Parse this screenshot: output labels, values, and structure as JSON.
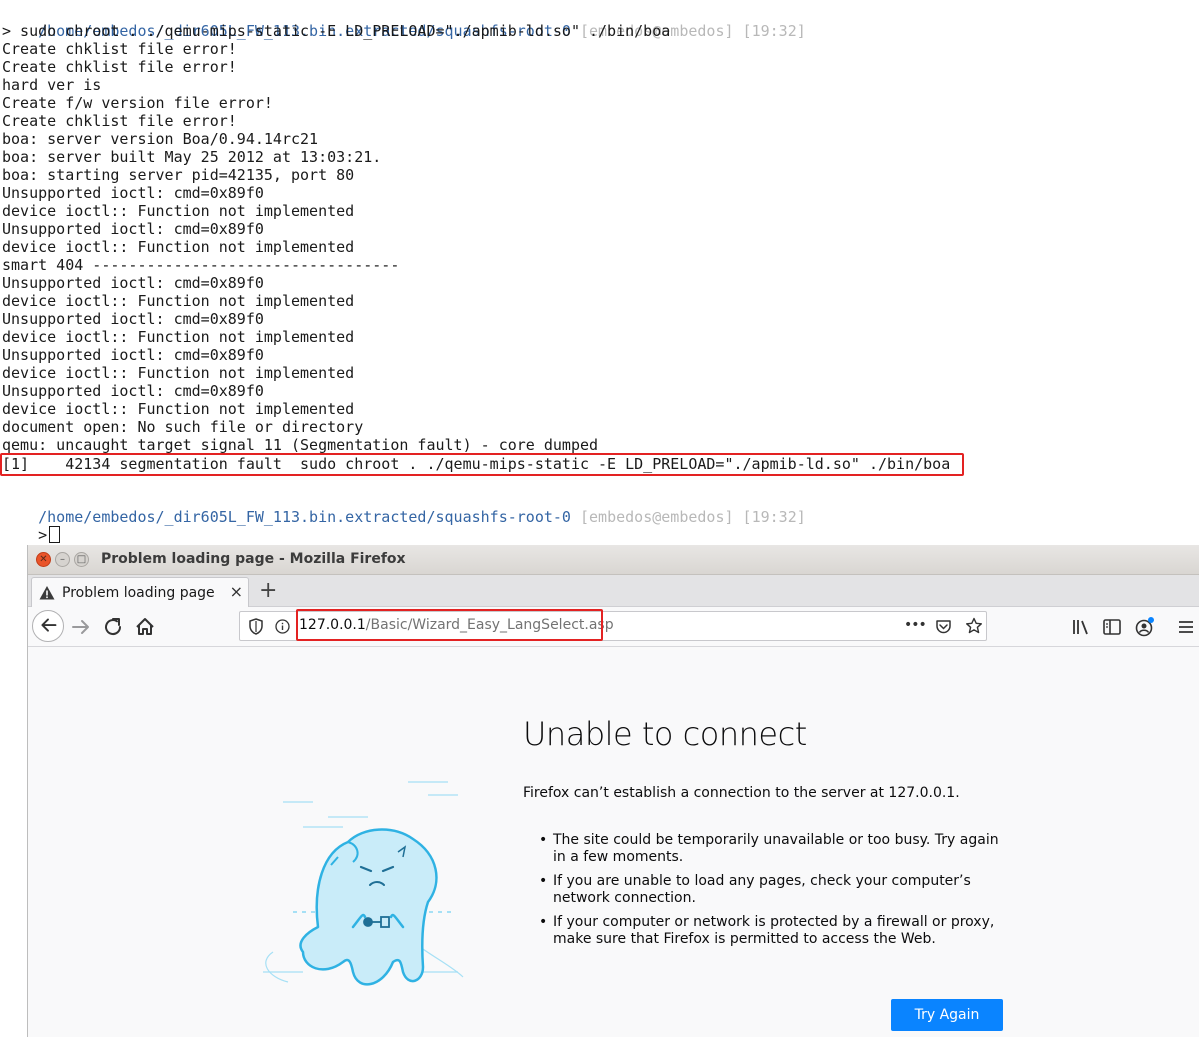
{
  "terminal": {
    "prompt_path": "/home/embedos/_dir605L_FW_113.bin.extracted/squashfs-root-0",
    "prompt_user": "[embedos@embedos]",
    "prompt_time": "[19:32]",
    "command": "> sudo chroot . ./qemu-mips-static -E LD_PRELOAD=\"./apmib-ld.so\" ./bin/boa",
    "output": [
      "Create chklist file error!",
      "Create chklist file error!",
      "hard ver is",
      "Create f/w version file error!",
      "Create chklist file error!",
      "boa: server version Boa/0.94.14rc21",
      "boa: server built May 25 2012 at 13:03:21.",
      "boa: starting server pid=42135, port 80",
      "Unsupported ioctl: cmd=0x89f0",
      "device ioctl:: Function not implemented",
      "Unsupported ioctl: cmd=0x89f0",
      "device ioctl:: Function not implemented",
      "smart 404 ----------------------------------",
      "Unsupported ioctl: cmd=0x89f0",
      "device ioctl:: Function not implemented",
      "Unsupported ioctl: cmd=0x89f0",
      "device ioctl:: Function not implemented",
      "Unsupported ioctl: cmd=0x89f0",
      "device ioctl:: Function not implemented",
      "Unsupported ioctl: cmd=0x89f0",
      "device ioctl:: Function not implemented",
      "document open: No such file or directory",
      "qemu: uncaught target signal 11 (Segmentation fault) - core dumped"
    ],
    "fault_line": "[1]    42134 segmentation fault  sudo chroot . ./qemu-mips-static -E LD_PRELOAD=\"./apmib-ld.so\" ./bin/boa",
    "second_prompt_path": "/home/embedos/_dir605L_FW_113.bin.extracted/squashfs-root-0",
    "second_prompt_user": "[embedos@embedos]",
    "second_prompt_time": "[19:32]",
    "input_prompt": ">"
  },
  "firefox": {
    "window_title": "Problem loading page - Mozilla Firefox",
    "tab_title": "Problem loading page",
    "tab_close": "×",
    "new_tab": "+",
    "url_host": "127.0.0.1",
    "url_path": "/Basic/Wizard_Easy_LangSelect.asp",
    "page_actions": "•••"
  },
  "error_page": {
    "title": "Unable to connect",
    "description": "Firefox can’t establish a connection to the server at 127.0.0.1.",
    "bullets": [
      "The site could be temporarily unavailable or too busy. Try again in a few moments.",
      "If you are unable to load any pages, check your computer’s network connection.",
      "If your computer or network is protected by a firewall or proxy, make sure that Firefox is permitted to access the Web."
    ],
    "button": "Try Again"
  },
  "colors": {
    "prompt_path": "#3465a4",
    "highlight": "#e32222",
    "button": "#0a84ff"
  }
}
